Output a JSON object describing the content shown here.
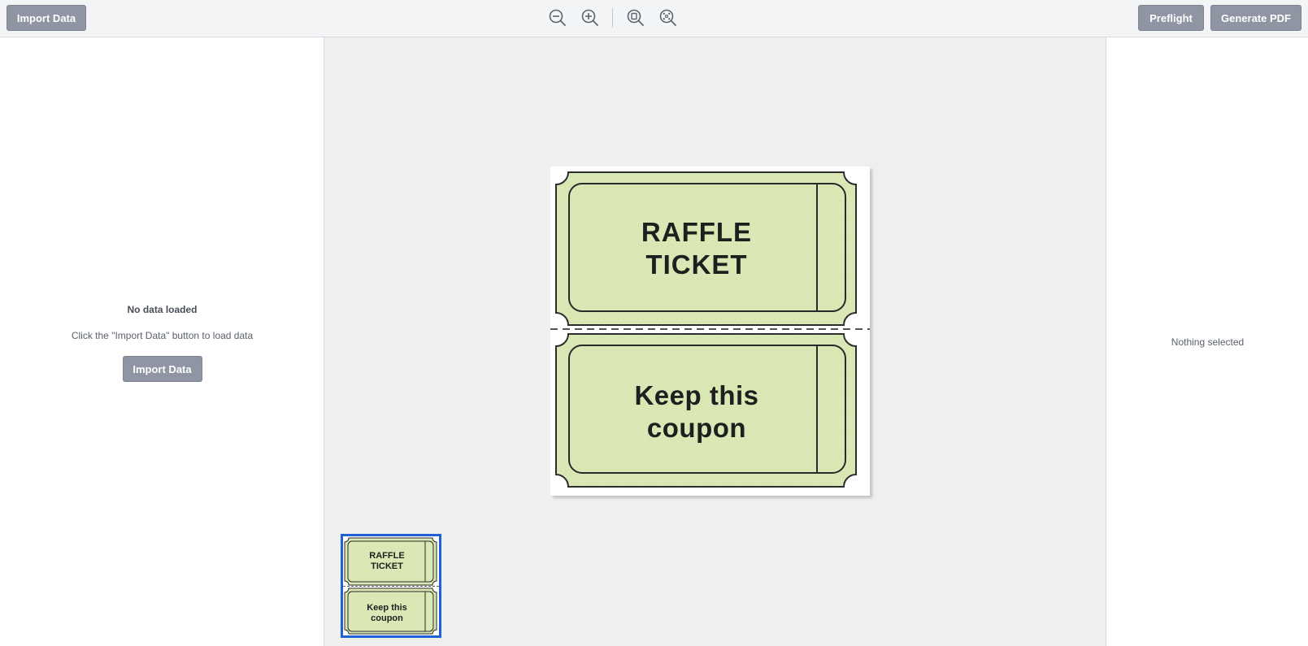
{
  "toolbar": {
    "import_label": "Import Data",
    "preflight_label": "Preflight",
    "generate_label": "Generate PDF",
    "icons": [
      "zoom-out-icon",
      "zoom-in-icon",
      "fit-page-icon",
      "fit-width-icon"
    ]
  },
  "left_panel": {
    "empty_title": "No data loaded",
    "empty_description": "Click the \"Import Data\" button to load data",
    "import_label": "Import Data"
  },
  "right_panel": {
    "empty_text": "Nothing selected"
  },
  "ticket": {
    "top_text": "RAFFLE\nTICKET",
    "bottom_text": "Keep this\ncoupon",
    "fill_color": "#d9e8b4",
    "stroke_color": "#2a2a2a"
  },
  "colors": {
    "button_bg": "#8f95a3",
    "thumbnail_selected_border": "#1c64d6",
    "canvas_bg": "#efeff0"
  }
}
